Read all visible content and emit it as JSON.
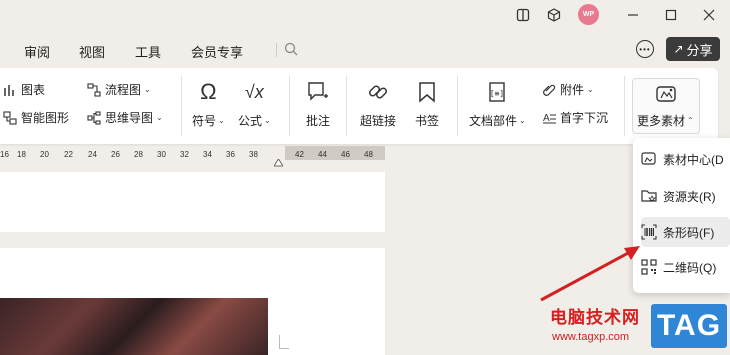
{
  "window": {
    "avatar_text": "WP"
  },
  "menu": {
    "items": [
      "审阅",
      "视图",
      "工具",
      "会员专享"
    ],
    "share_label": "分享"
  },
  "ribbon": {
    "chart_label": "图表",
    "smartart_label": "智能图形",
    "flowchart_label": "流程图",
    "mindmap_label": "思维导图",
    "symbol_label": "符号",
    "formula_label": "公式",
    "comment_label": "批注",
    "hyperlink_label": "超链接",
    "bookmark_label": "书签",
    "docpart_label": "文档部件",
    "attachment_label": "附件",
    "dropcap_label": "首字下沉",
    "more_assets_label": "更多素材"
  },
  "ruler": {
    "ticks": [
      "16",
      "18",
      "20",
      "22",
      "24",
      "26",
      "28",
      "30",
      "32",
      "34",
      "36",
      "38",
      "42",
      "44",
      "46",
      "48"
    ]
  },
  "dropdown": {
    "items": [
      {
        "label": "素材中心(D",
        "icon": "asset-center-icon"
      },
      {
        "label": "资源夹(R)",
        "icon": "resource-folder-icon"
      },
      {
        "label": "条形码(F)",
        "icon": "barcode-icon"
      },
      {
        "label": "二维码(Q)",
        "icon": "qrcode-icon"
      }
    ]
  },
  "watermark": {
    "site_name": "电脑技术网",
    "url": "www.tagxp.com",
    "tag": "TAG"
  },
  "colors": {
    "arrow": "#d42020",
    "share_bg": "#3b3b3b",
    "avatar_bg": "#e77a8e",
    "tag_bg": "#2f86d6"
  }
}
